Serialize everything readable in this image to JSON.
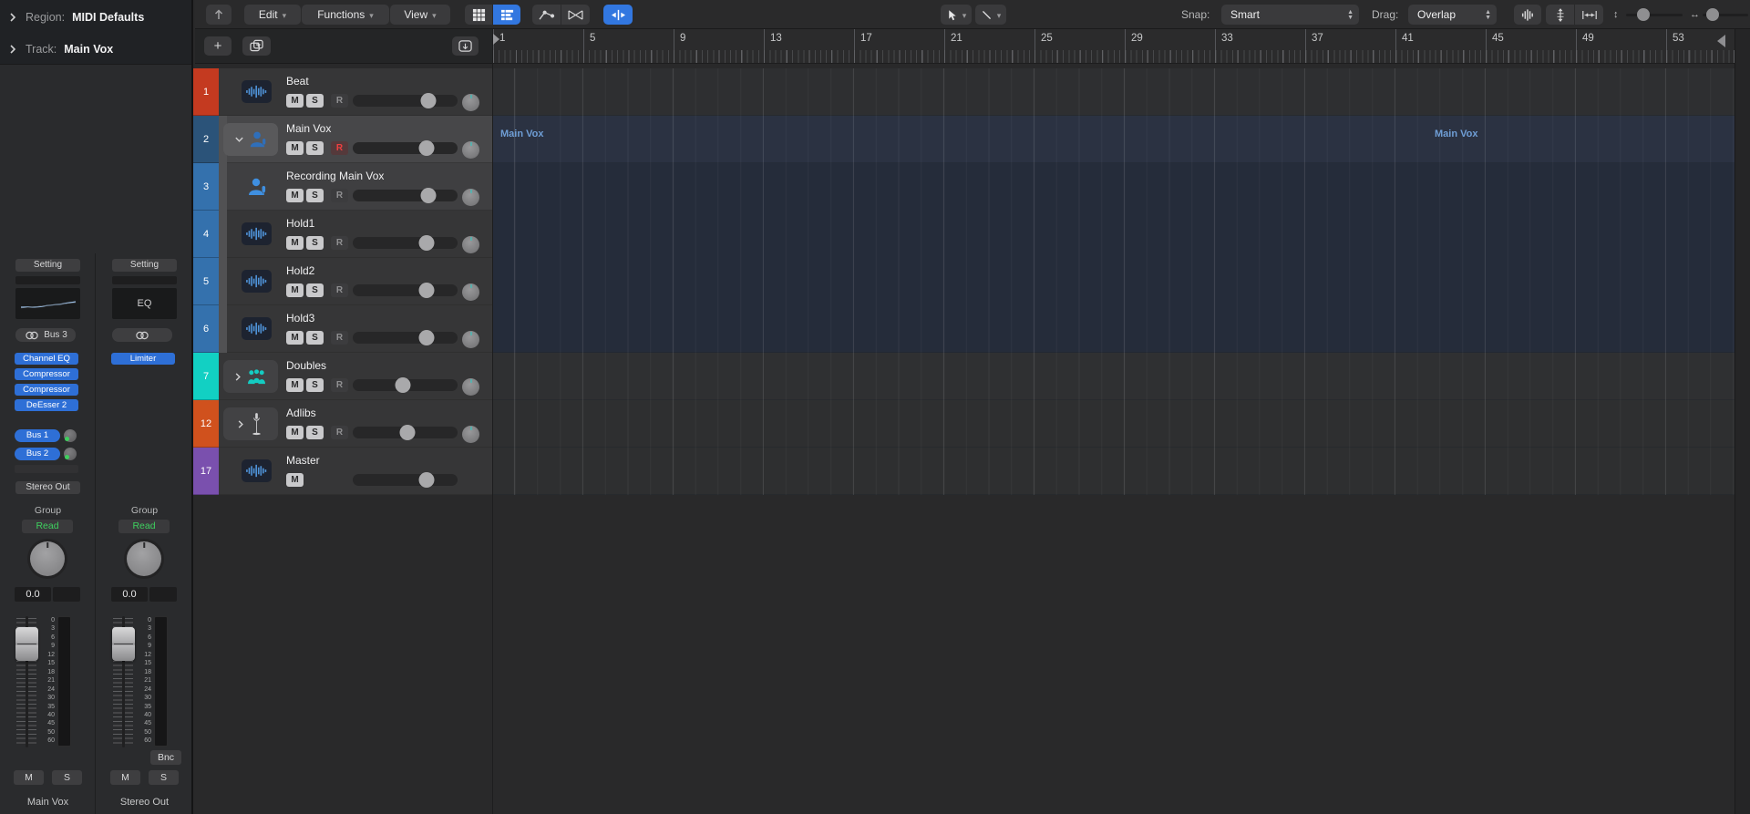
{
  "inspector": {
    "region_label": "Region:",
    "region_value": "MIDI Defaults",
    "track_label": "Track:",
    "track_value": "Main Vox",
    "strips": {
      "db_scale": "0\n3\n6\n9\n12\n15\n18\n21\n24\n30\n35\n40\n45\n50\n60",
      "left": {
        "setting": "Setting",
        "input": "Bus 3",
        "plugins": [
          "Channel EQ",
          "Compressor",
          "Compressor",
          "DeEsser 2"
        ],
        "sends": [
          "Bus 1",
          "Bus 2"
        ],
        "output": "Stereo Out",
        "group": "Group",
        "automation": "Read",
        "volume": "0.0",
        "mute": "M",
        "solo": "S",
        "name": "Main Vox"
      },
      "right": {
        "setting": "Setting",
        "eq": "EQ",
        "plugins": [
          "Limiter"
        ],
        "group": "Group",
        "automation": "Read",
        "volume": "0.0",
        "bounce": "Bnc",
        "mute": "M",
        "solo": "S",
        "name": "Stereo Out"
      }
    }
  },
  "toolbar": {
    "menus": [
      "Edit",
      "Functions",
      "View"
    ],
    "snap_label": "Snap:",
    "snap_value": "Smart",
    "drag_label": "Drag:",
    "drag_value": "Overlap"
  },
  "subbar": {
    "add_label": "+"
  },
  "tracks": [
    {
      "num": "1",
      "name": "Beat",
      "color": "#c43a20",
      "mute": "M",
      "solo": "S",
      "record": "R",
      "vol": "72%",
      "armed": false
    },
    {
      "num": "2",
      "name": "Main Vox",
      "color": "#2b5379",
      "mute": "M",
      "solo": "S",
      "record": "R",
      "vol": "70%",
      "armed": true
    },
    {
      "num": "3",
      "name": "Recording Main Vox",
      "color": "#3471ad",
      "mute": "M",
      "solo": "S",
      "record": "R",
      "vol": "72%",
      "armed": false
    },
    {
      "num": "4",
      "name": "Hold1",
      "color": "#3471ad",
      "mute": "M",
      "solo": "S",
      "record": "R",
      "vol": "70%",
      "armed": false
    },
    {
      "num": "5",
      "name": "Hold2",
      "color": "#3471ad",
      "mute": "M",
      "solo": "S",
      "record": "R",
      "vol": "70%",
      "armed": false
    },
    {
      "num": "6",
      "name": "Hold3",
      "color": "#3471ad",
      "mute": "M",
      "solo": "S",
      "record": "R",
      "vol": "70%",
      "armed": false
    },
    {
      "num": "7",
      "name": "Doubles",
      "color": "#12d0c3",
      "mute": "M",
      "solo": "S",
      "record": "R",
      "vol": "48%",
      "armed": false
    },
    {
      "num": "12",
      "name": "Adlibs",
      "color": "#d0511d",
      "mute": "M",
      "solo": "S",
      "record": "R",
      "vol": "52%",
      "armed": false
    },
    {
      "num": "17",
      "name": "Master",
      "color": "#7a50ae",
      "mute": "M",
      "solo": null,
      "record": null,
      "vol": "70%",
      "armed": false
    }
  ],
  "ruler": {
    "bars": [
      "1",
      "5",
      "9",
      "13",
      "17",
      "21",
      "25",
      "29",
      "33",
      "37",
      "41",
      "45",
      "49",
      "53"
    ]
  },
  "regions": [
    {
      "label": "Main Vox"
    },
    {
      "label": "Main Vox"
    }
  ],
  "colors": {
    "accent_blue": "#2e6fd6",
    "selected_blue": "#3277e0",
    "armed_red": "#ee4040",
    "automation_green": "#3ed15f",
    "region_label_blue": "#6f9ed6"
  }
}
